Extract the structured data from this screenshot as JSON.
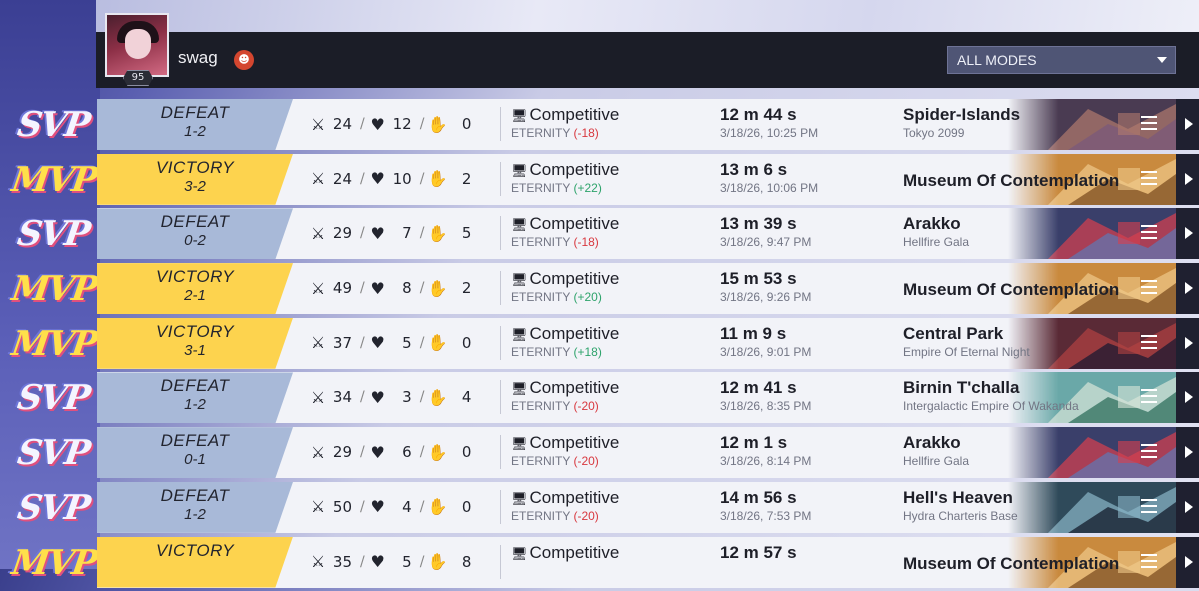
{
  "profile": {
    "username": "swag",
    "level": "95"
  },
  "filter": {
    "selected": "ALL MODES"
  },
  "icons": {
    "kills": "crossed-swords-icon",
    "deaths": "broken-heart-icon",
    "assists": "helping-hand-icon",
    "mode": "monitor-icon",
    "menu": "menu-icon",
    "play": "play-icon"
  },
  "colors": {
    "defeat": "#a8b9d8",
    "victory": "#fdd34e",
    "elo_loss": "#d8383f",
    "elo_gain": "#2ea36b"
  },
  "matches": [
    {
      "honor": "SVP",
      "result": "DEFEAT",
      "score": "1-2",
      "kills": "24",
      "deaths": "12",
      "assists": "0",
      "mode": "Competitive",
      "elo_label": "ETERNITY",
      "elo_change": "(-18)",
      "duration": "12 m 44 s",
      "datetime": "3/18/26, 10:25 PM",
      "map": "Spider-Islands",
      "map_sub": "Tokyo 2099"
    },
    {
      "honor": "MVP",
      "result": "VICTORY",
      "score": "3-2",
      "kills": "24",
      "deaths": "10",
      "assists": "2",
      "mode": "Competitive",
      "elo_label": "ETERNITY",
      "elo_change": "(+22)",
      "duration": "13 m 6 s",
      "datetime": "3/18/26, 10:06 PM",
      "map": "Museum Of Contemplation",
      "map_sub": ""
    },
    {
      "honor": "SVP",
      "result": "DEFEAT",
      "score": "0-2",
      "kills": "29",
      "deaths": "7",
      "assists": "5",
      "mode": "Competitive",
      "elo_label": "ETERNITY",
      "elo_change": "(-18)",
      "duration": "13 m 39 s",
      "datetime": "3/18/26, 9:47 PM",
      "map": "Arakko",
      "map_sub": "Hellfire Gala"
    },
    {
      "honor": "MVP",
      "result": "VICTORY",
      "score": "2-1",
      "kills": "49",
      "deaths": "8",
      "assists": "2",
      "mode": "Competitive",
      "elo_label": "ETERNITY",
      "elo_change": "(+20)",
      "duration": "15 m 53 s",
      "datetime": "3/18/26, 9:26 PM",
      "map": "Museum Of Contemplation",
      "map_sub": ""
    },
    {
      "honor": "MVP",
      "result": "VICTORY",
      "score": "3-1",
      "kills": "37",
      "deaths": "5",
      "assists": "0",
      "mode": "Competitive",
      "elo_label": "ETERNITY",
      "elo_change": "(+18)",
      "duration": "11 m 9 s",
      "datetime": "3/18/26, 9:01 PM",
      "map": "Central Park",
      "map_sub": "Empire Of Eternal Night"
    },
    {
      "honor": "SVP",
      "result": "DEFEAT",
      "score": "1-2",
      "kills": "34",
      "deaths": "3",
      "assists": "4",
      "mode": "Competitive",
      "elo_label": "ETERNITY",
      "elo_change": "(-20)",
      "duration": "12 m 41 s",
      "datetime": "3/18/26, 8:35 PM",
      "map": "Birnin T'challa",
      "map_sub": "Intergalactic Empire Of Wakanda"
    },
    {
      "honor": "SVP",
      "result": "DEFEAT",
      "score": "0-1",
      "kills": "29",
      "deaths": "6",
      "assists": "0",
      "mode": "Competitive",
      "elo_label": "ETERNITY",
      "elo_change": "(-20)",
      "duration": "12 m 1 s",
      "datetime": "3/18/26, 8:14 PM",
      "map": "Arakko",
      "map_sub": "Hellfire Gala"
    },
    {
      "honor": "SVP",
      "result": "DEFEAT",
      "score": "1-2",
      "kills": "50",
      "deaths": "4",
      "assists": "0",
      "mode": "Competitive",
      "elo_label": "ETERNITY",
      "elo_change": "(-20)",
      "duration": "14 m 56 s",
      "datetime": "3/18/26, 7:53 PM",
      "map": "Hell's Heaven",
      "map_sub": "Hydra Charteris Base"
    },
    {
      "honor": "MVP",
      "result": "VICTORY",
      "score": "",
      "kills": "35",
      "deaths": "5",
      "assists": "8",
      "mode": "Competitive",
      "elo_label": "",
      "elo_change": "",
      "duration": "12 m 57 s",
      "datetime": "",
      "map": "Museum Of Contemplation",
      "map_sub": ""
    }
  ]
}
